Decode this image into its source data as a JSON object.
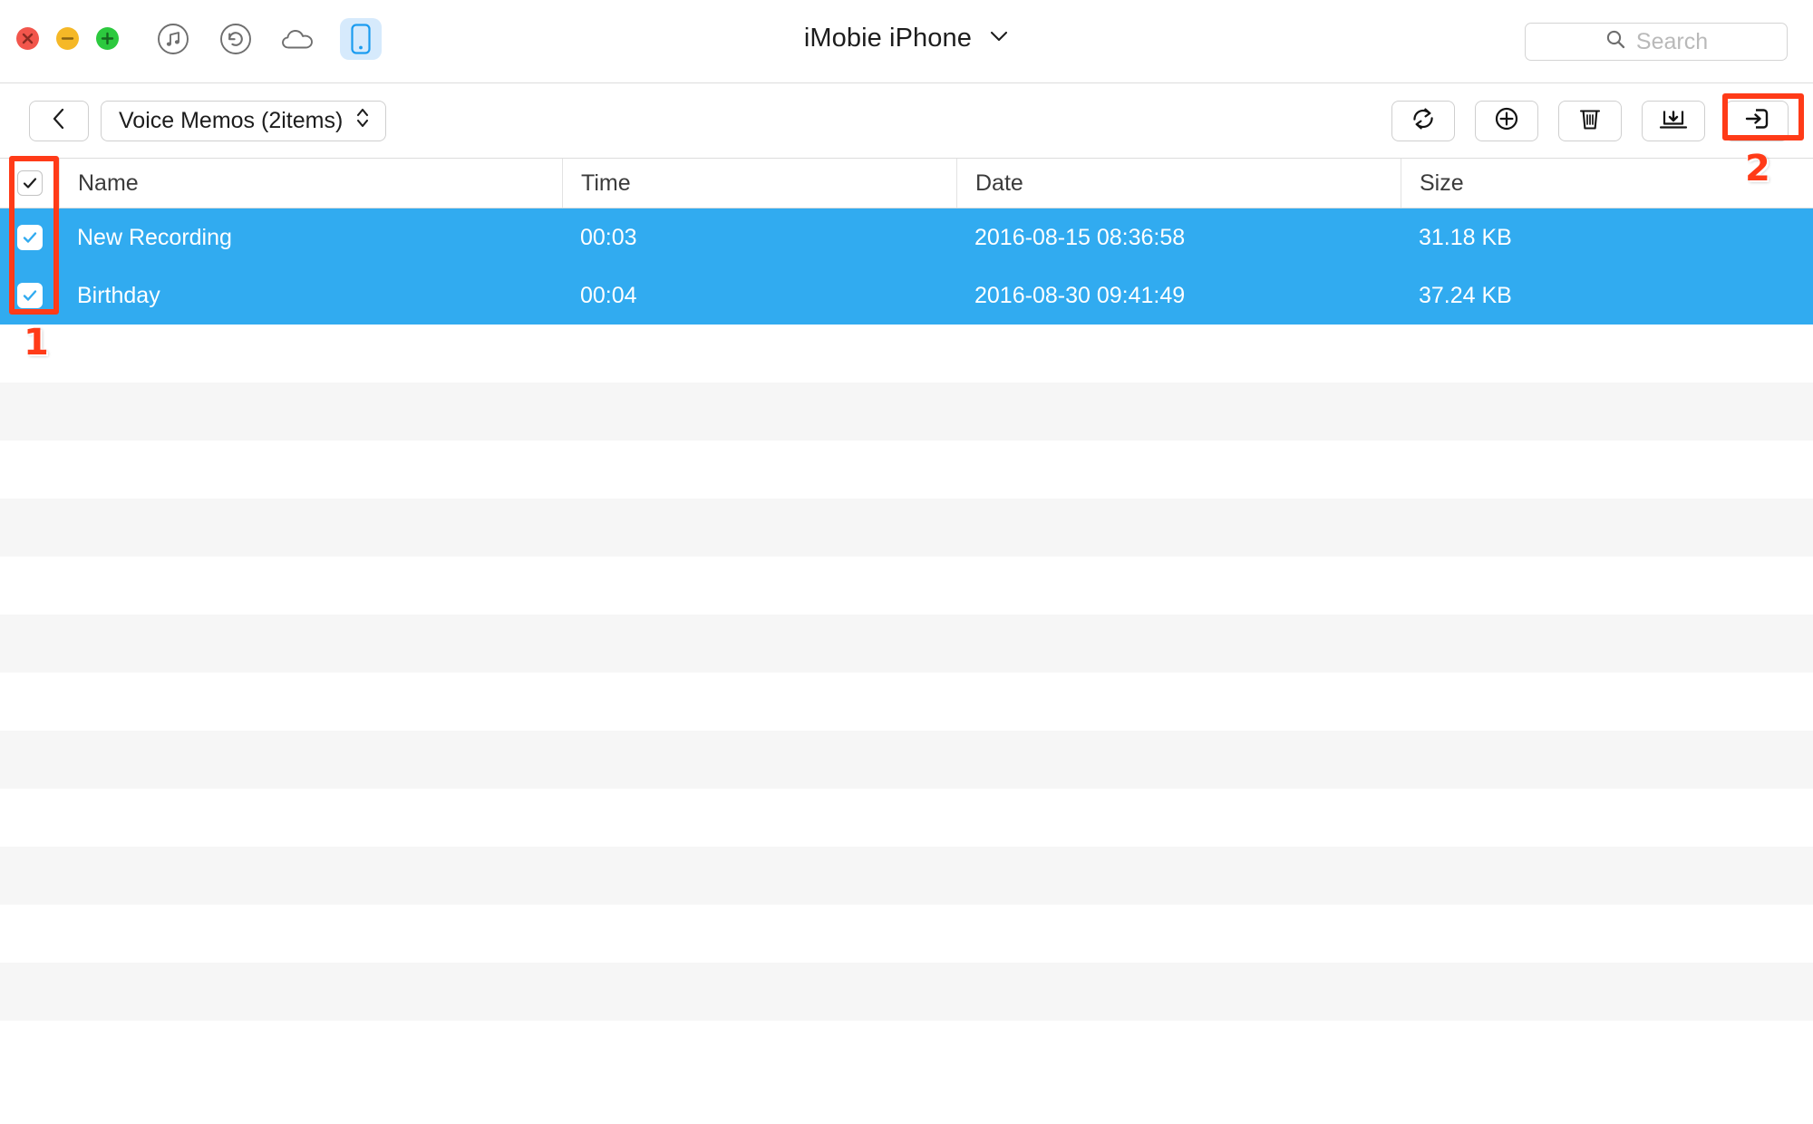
{
  "window": {
    "title": "iMobie iPhone",
    "traffic_lights": [
      "close-button",
      "minimize-button",
      "maximize-button"
    ],
    "nav_icons": [
      {
        "name": "music-icon",
        "label": "Music"
      },
      {
        "name": "restore-icon",
        "label": "Restore"
      },
      {
        "name": "cloud-icon",
        "label": "Cloud"
      },
      {
        "name": "device-icon",
        "label": "Device",
        "active": true
      }
    ]
  },
  "search": {
    "placeholder": "Search",
    "value": "",
    "icon": "search-icon"
  },
  "toolbar": {
    "back_label": "",
    "back_icon": "chevron-left-icon",
    "breadcrumb": "Voice Memos (2items)",
    "breadcrumb_icon": "chevron-up-down-icon",
    "buttons": [
      {
        "name": "refresh-button",
        "icon": "refresh-icon",
        "label": "Refresh"
      },
      {
        "name": "add-button",
        "icon": "plus-circle-icon",
        "label": "Add"
      },
      {
        "name": "delete-button",
        "icon": "trash-icon",
        "label": "Delete"
      },
      {
        "name": "export-to-mac-button",
        "icon": "laptop-download-icon",
        "label": "To Mac"
      },
      {
        "name": "export-to-device-button",
        "icon": "arrow-into-device-icon",
        "label": "To Device",
        "highlighted": true
      }
    ]
  },
  "table": {
    "select_all_checked": true,
    "columns": [
      "Name",
      "Time",
      "Date",
      "Size"
    ],
    "rows": [
      {
        "checked": true,
        "selected": true,
        "name": "New Recording",
        "time": "00:03",
        "date": "2016-08-15 08:36:58",
        "size": "31.18 KB"
      },
      {
        "checked": true,
        "selected": true,
        "name": "Birthday",
        "time": "00:04",
        "date": "2016-08-30 09:41:49",
        "size": "37.24 KB"
      }
    ],
    "empty_row_count": 13
  },
  "annotations": [
    {
      "number": "1",
      "target": "checkbox-column"
    },
    {
      "number": "2",
      "target": "export-to-device-button"
    }
  ],
  "colors": {
    "selection_blue": "#31abf0",
    "annotation_red": "#ff3b18",
    "device_active_bg": "#d6eafc",
    "stripe_gray": "#f6f6f6"
  }
}
